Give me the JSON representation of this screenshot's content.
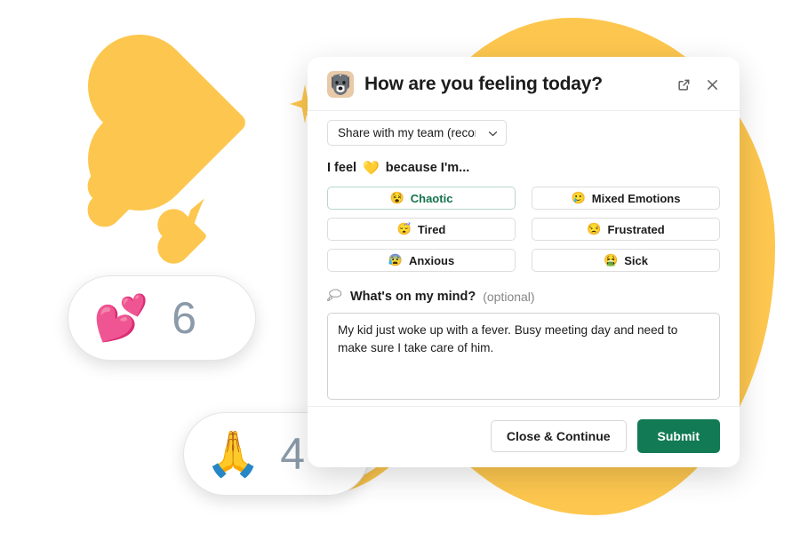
{
  "modal": {
    "avatar_name": "dog-avatar",
    "title": "How are you feeling today?",
    "open_external_icon": "external-link-icon",
    "close_icon": "close-icon",
    "share": {
      "value": "Share with my team (recommend",
      "chevron_icon": "chevron-down-icon"
    },
    "prompt": {
      "prefix": "I feel",
      "emoji": "💛",
      "suffix": "because I'm..."
    },
    "moods": [
      {
        "emoji": "😵",
        "label": "Chaotic",
        "selected": true
      },
      {
        "emoji": "🥲",
        "label": "Mixed Emotions",
        "selected": false
      },
      {
        "emoji": "😴",
        "label": "Tired",
        "selected": false
      },
      {
        "emoji": "😒",
        "label": "Frustrated",
        "selected": false
      },
      {
        "emoji": "😰",
        "label": "Anxious",
        "selected": false
      },
      {
        "emoji": "🤮",
        "label": "Sick",
        "selected": false
      }
    ],
    "note": {
      "icon": "thought-bubble-icon",
      "label": "What's on my mind?",
      "optional_text": "(optional)",
      "value": "My kid just woke up with a fever. Busy meeting day and need to make sure I take care of him.",
      "placeholder": ""
    },
    "footer": {
      "close_continue_label": "Close & Continue",
      "submit_label": "Submit"
    }
  },
  "reactions": [
    {
      "name": "hearts",
      "emoji": "💕",
      "count": "6"
    },
    {
      "name": "praying-hands",
      "emoji": "🙏",
      "count": "4"
    }
  ],
  "colors": {
    "brand_yellow": "#fdc74f",
    "submit_green": "#127a55",
    "selected_mood_text": "#12724d",
    "count_grey": "#8a9aa8"
  }
}
